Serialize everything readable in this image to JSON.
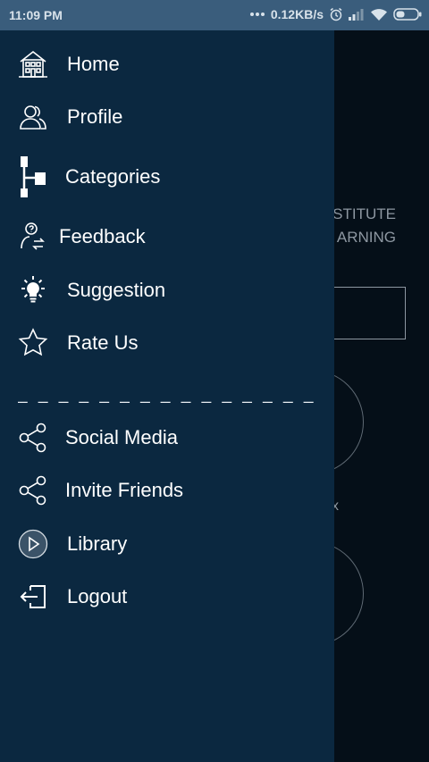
{
  "status_bar": {
    "time": "11:09 PM",
    "network_speed": "0.12KB/s",
    "icons": [
      "dots-icon",
      "alarm-icon",
      "signal-icon",
      "wifi-icon",
      "battery-icon"
    ]
  },
  "background_screen": {
    "title_line1": "STITUTE",
    "title_line2": "ARNING",
    "close_glyph": "x"
  },
  "drawer": {
    "items": [
      {
        "label": "Home",
        "icon": "home-icon"
      },
      {
        "label": "Profile",
        "icon": "profile-icon"
      },
      {
        "label": "Categories",
        "icon": "categories-icon"
      },
      {
        "label": "Feedback",
        "icon": "feedback-icon"
      },
      {
        "label": "Suggestion",
        "icon": "lightbulb-icon"
      },
      {
        "label": "Rate Us",
        "icon": "star-icon"
      }
    ],
    "divider": "_ _ _ _ _ _ _ _ _ _ _ _ _ _ _ _ _",
    "secondary_items": [
      {
        "label": "Social Media",
        "icon": "share-icon"
      },
      {
        "label": "Invite Friends",
        "icon": "share-icon"
      },
      {
        "label": "Library",
        "icon": "play-circle-icon"
      },
      {
        "label": "Logout",
        "icon": "logout-icon"
      }
    ]
  },
  "colors": {
    "status_bar": "#3a5d7c",
    "drawer": "#0b2840",
    "background": "#050f18",
    "text": "#ffffff"
  }
}
